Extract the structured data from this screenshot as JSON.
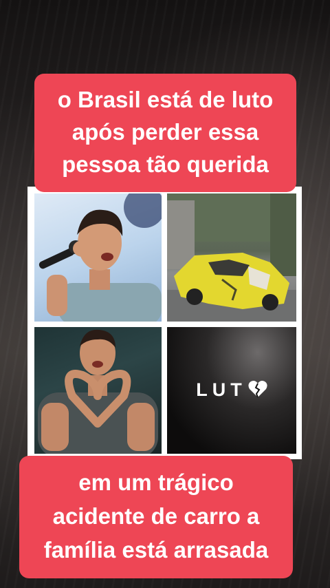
{
  "caption_top": {
    "lines": [
      "o Brasil está de luto",
      "após perder essa",
      "pessoa tão querida"
    ]
  },
  "collage": {
    "luto_text": "LUT",
    "heart_icon": "broken-heart-icon"
  },
  "caption_bottom": {
    "lines": [
      "em um trágico",
      "acidente de carro a",
      "família está arrasada"
    ]
  },
  "colors": {
    "caption_background": "#ee4655",
    "caption_text": "#ffffff",
    "collage_border": "#ffffff"
  }
}
